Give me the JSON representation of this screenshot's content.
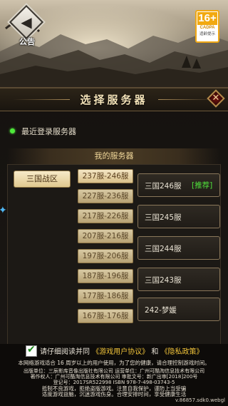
{
  "notice": {
    "label": "公告"
  },
  "age_rating": {
    "age": "16+",
    "org": "CADPA",
    "note": "适龄提示"
  },
  "panel": {
    "title": "选择服务器",
    "recent_label": "最近登录服务器",
    "my_servers_label": "我的服务器",
    "zone_tab": "三国战区",
    "ranges": [
      "237服-246服",
      "227服-236服",
      "217服-226服",
      "207服-216服",
      "197服-206服",
      "187服-196服",
      "177服-186服",
      "167服-176服"
    ],
    "servers": [
      {
        "name": "三国246服",
        "tag": "[推荐]"
      },
      {
        "name": "三国245服",
        "tag": ""
      },
      {
        "name": "三国244服",
        "tag": ""
      },
      {
        "name": "三国243服",
        "tag": ""
      },
      {
        "name": "242-梦媛",
        "tag": ""
      }
    ]
  },
  "agreement": {
    "prefix": "请仔细阅读并同",
    "link1": "《游戏用户协议》",
    "and": "和",
    "link2": "《隐私政策》"
  },
  "footer": {
    "age_line": "本网络游戏适合 16 周岁以上的用户使用，为了您的健康，请合理控制游戏时间。",
    "publisher_line": "出版单位：三辰影库音像出版社有限公司  运营单位：广州可酷淘信息技术有限公司",
    "copyright_line": "著作权人：广州可酷淘信息技术有限公司  审批文号：新广出审[2018]200号",
    "isbn_line": "登记号：2017SR522998  ISBN 978-7-498-03743-5",
    "advice_line1": "抵制不良游戏，拒绝盗版游戏。注意自我保护，谨防上当受骗",
    "advice_line2": "适度游戏益脑，沉迷游戏伤身。合理安排时间，享受健康生活",
    "version": "v.86857.sdk0.webgl"
  }
}
